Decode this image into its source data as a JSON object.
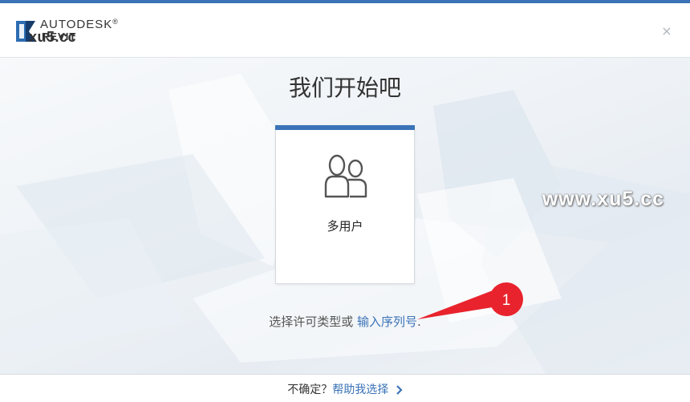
{
  "header": {
    "brand_top": "AUTODESK",
    "brand_bottom": "REVIT",
    "trademark": "®",
    "watermark_left": "xu5.cc",
    "close_icon": "close-icon",
    "close_glyph": "×"
  },
  "main": {
    "title": "我们开始吧",
    "card": {
      "label": "多用户",
      "icon": "multi-user-icon",
      "accent_color": "#3a73b7"
    },
    "license_text": "选择许可类型或",
    "serial_link": "输入序列号",
    "license_suffix": ".",
    "annotation_number": "1",
    "annotation_color": "#e8232d",
    "watermark_right": "www.xu5.cc"
  },
  "footer": {
    "question": "不确定？",
    "help_link": "帮助我选择",
    "chevron_icon": "chevron-right-icon"
  },
  "colors": {
    "accent": "#3a73b7",
    "top_bar": "#3a73b7"
  }
}
